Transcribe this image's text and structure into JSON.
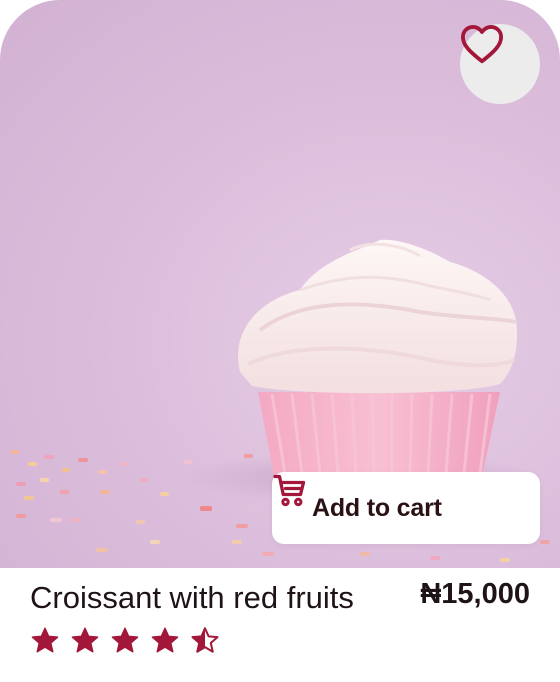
{
  "product": {
    "name": "Croissant with red fruits",
    "price": "₦15,000",
    "rating": 4.5,
    "rating_max": 5
  },
  "actions": {
    "add_to_cart_label": "Add to cart"
  },
  "icons": {
    "favorite": "heart-outline-icon",
    "cart": "shopping-cart-icon",
    "star": "star-icon"
  },
  "colors": {
    "accent": "#a3173a",
    "hero_background": "#dcbfdc",
    "text": "#1f1415"
  }
}
